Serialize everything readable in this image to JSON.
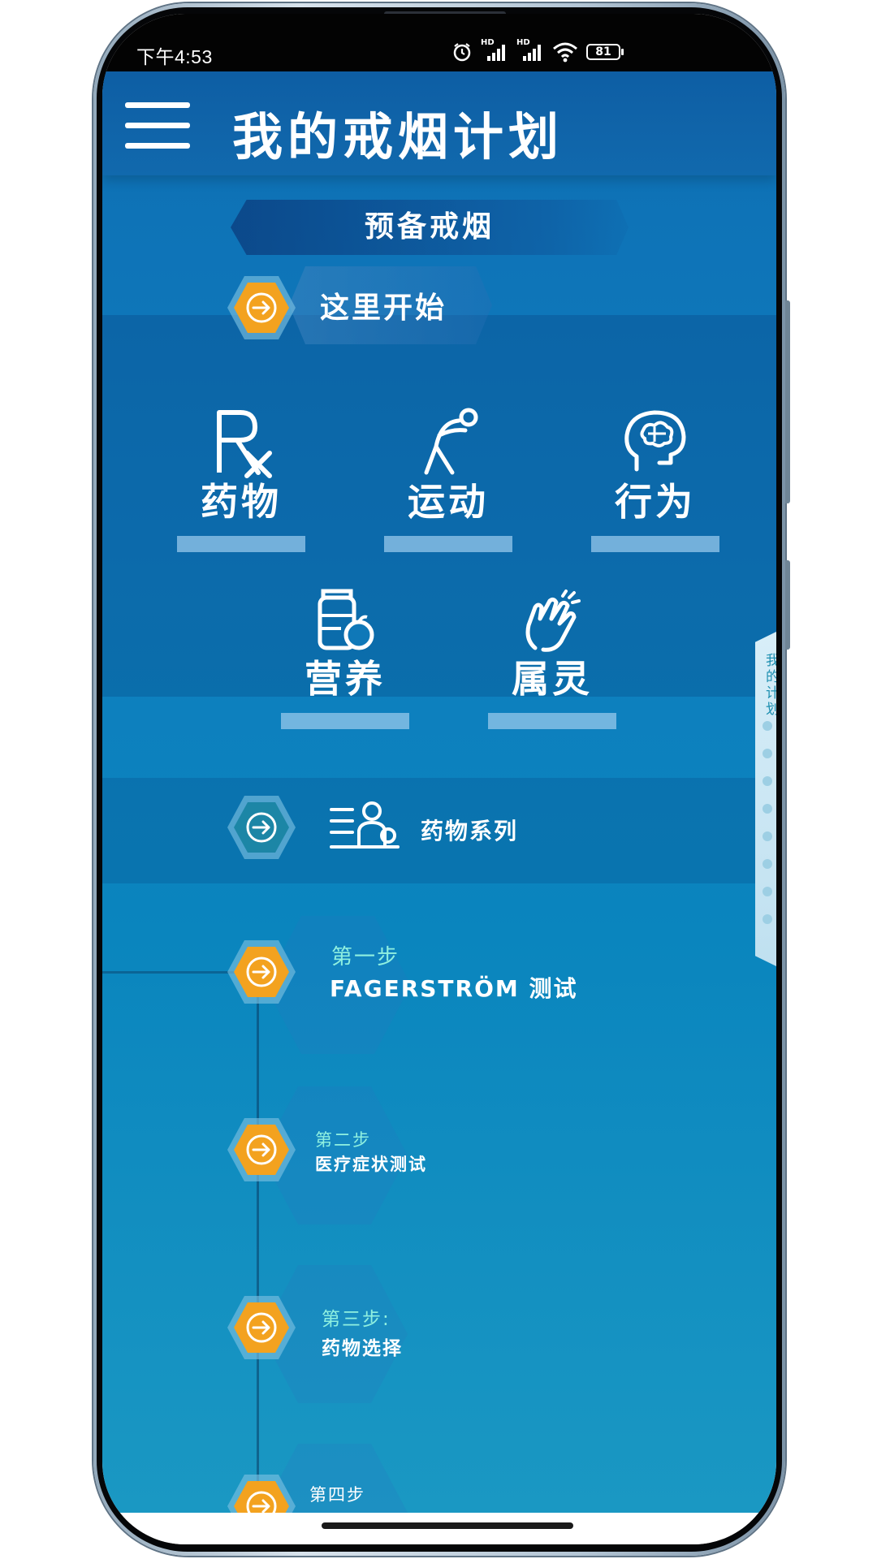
{
  "status": {
    "time": "下午4:53",
    "network_1": "HD",
    "network_2": "HD",
    "battery": "81"
  },
  "header": {
    "title": "我的戒烟计划"
  },
  "phase": {
    "label": "预备戒烟"
  },
  "start": {
    "label": "这里开始"
  },
  "categories": [
    {
      "label": "药物",
      "icon": "rx-icon"
    },
    {
      "label": "运动",
      "icon": "exercise-icon"
    },
    {
      "label": "行为",
      "icon": "brain-icon"
    },
    {
      "label": "营养",
      "icon": "nutrition-icon"
    },
    {
      "label": "属灵",
      "icon": "praying-hands-icon"
    }
  ],
  "series": {
    "label": "药物系列"
  },
  "steps": [
    {
      "step": "第一步",
      "title": "FAGERSTRÖM 测试"
    },
    {
      "step": "第二步",
      "title": "医疗症状测试"
    },
    {
      "step": "第三步:",
      "title": "药物选择"
    },
    {
      "step": "第四步",
      "title": ""
    }
  ],
  "side_tab": {
    "label": "我的计划"
  },
  "colors": {
    "accent_orange": "#f3a21f",
    "header_blue": "#0e5ea4",
    "step_text_teal": "#8ff0e0"
  }
}
